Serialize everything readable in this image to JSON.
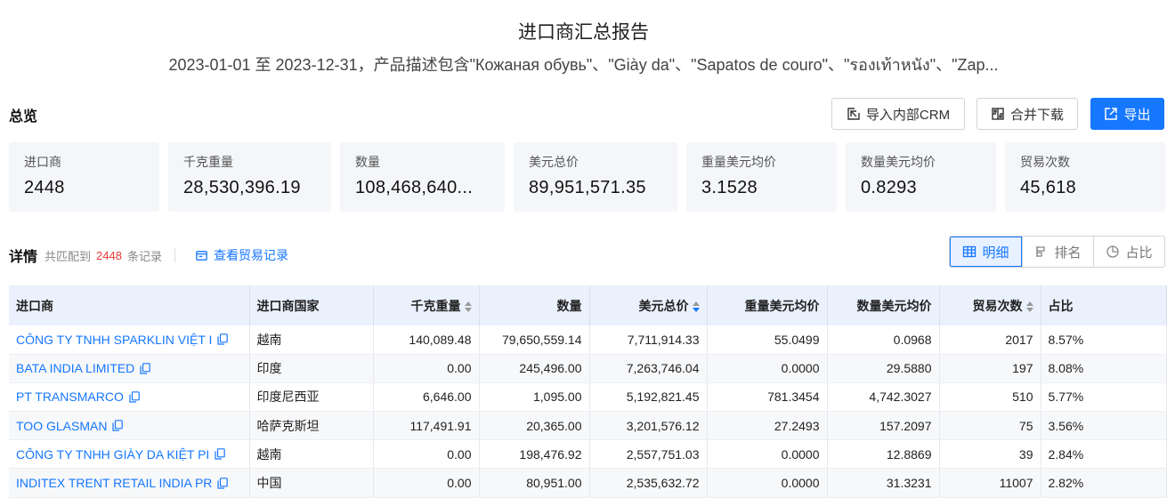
{
  "report": {
    "title": "进口商汇总报告",
    "subtitle": "2023-01-01 至 2023-12-31，产品描述包含\"Кожаная обувь\"、\"Giày da\"、\"Sapatos de couro\"、\"รองเท้าหนัง\"、\"Zap..."
  },
  "overview": {
    "heading": "总览",
    "buttons": {
      "crm": "导入内部CRM",
      "merge": "合并下载",
      "export": "导出"
    },
    "cards": [
      {
        "label": "进口商",
        "value": "2448"
      },
      {
        "label": "千克重量",
        "value": "28,530,396.19"
      },
      {
        "label": "数量",
        "value": "108,468,640..."
      },
      {
        "label": "美元总价",
        "value": "89,951,571.35"
      },
      {
        "label": "重量美元均价",
        "value": "3.1528"
      },
      {
        "label": "数量美元均价",
        "value": "0.8293"
      },
      {
        "label": "贸易次数",
        "value": "45,618"
      }
    ]
  },
  "details": {
    "heading": "详情",
    "matched_prefix": "共匹配到",
    "matched_count": "2448",
    "matched_suffix": "条记录",
    "view_link": "查看贸易记录",
    "views": {
      "detail": "明细",
      "rank": "排名",
      "share": "占比"
    }
  },
  "table": {
    "columns": {
      "importer": "进口商",
      "country": "进口商国家",
      "weight": "千克重量",
      "quantity": "数量",
      "total_usd": "美元总价",
      "weight_avg": "重量美元均价",
      "qty_avg": "数量美元均价",
      "trades": "贸易次数",
      "share": "占比"
    },
    "rows": [
      {
        "importer": "CÔNG TY TNHH SPARKLIN VIỆT I",
        "country": "越南",
        "weight": "140,089.48",
        "quantity": "79,650,559.14",
        "total_usd": "7,711,914.33",
        "weight_avg": "55.0499",
        "qty_avg": "0.0968",
        "trades": "2017",
        "share": "8.57%"
      },
      {
        "importer": "BATA INDIA LIMITED",
        "country": "印度",
        "weight": "0.00",
        "quantity": "245,496.00",
        "total_usd": "7,263,746.04",
        "weight_avg": "0.0000",
        "qty_avg": "29.5880",
        "trades": "197",
        "share": "8.08%"
      },
      {
        "importer": "PT TRANSMARCO",
        "country": "印度尼西亚",
        "weight": "6,646.00",
        "quantity": "1,095.00",
        "total_usd": "5,192,821.45",
        "weight_avg": "781.3454",
        "qty_avg": "4,742.3027",
        "trades": "510",
        "share": "5.77%"
      },
      {
        "importer": "TOO GLASMAN",
        "country": "哈萨克斯坦",
        "weight": "117,491.91",
        "quantity": "20,365.00",
        "total_usd": "3,201,576.12",
        "weight_avg": "27.2493",
        "qty_avg": "157.2097",
        "trades": "75",
        "share": "3.56%"
      },
      {
        "importer": "CÔNG TY TNHH GIÀY DA KIỆT PI",
        "country": "越南",
        "weight": "0.00",
        "quantity": "198,476.92",
        "total_usd": "2,557,751.03",
        "weight_avg": "0.0000",
        "qty_avg": "12.8869",
        "trades": "39",
        "share": "2.84%"
      },
      {
        "importer": "INDITEX TRENT RETAIL INDIA PR",
        "country": "中国",
        "weight": "0.00",
        "quantity": "80,951.00",
        "total_usd": "2,535,632.72",
        "weight_avg": "0.0000",
        "qty_avg": "31.3231",
        "trades": "11007",
        "share": "2.82%"
      }
    ]
  },
  "colors": {
    "accent": "#1677ff",
    "count_red": "#e53935",
    "card_bg": "#f4f6f9",
    "header_bg": "#eaf1fd"
  }
}
